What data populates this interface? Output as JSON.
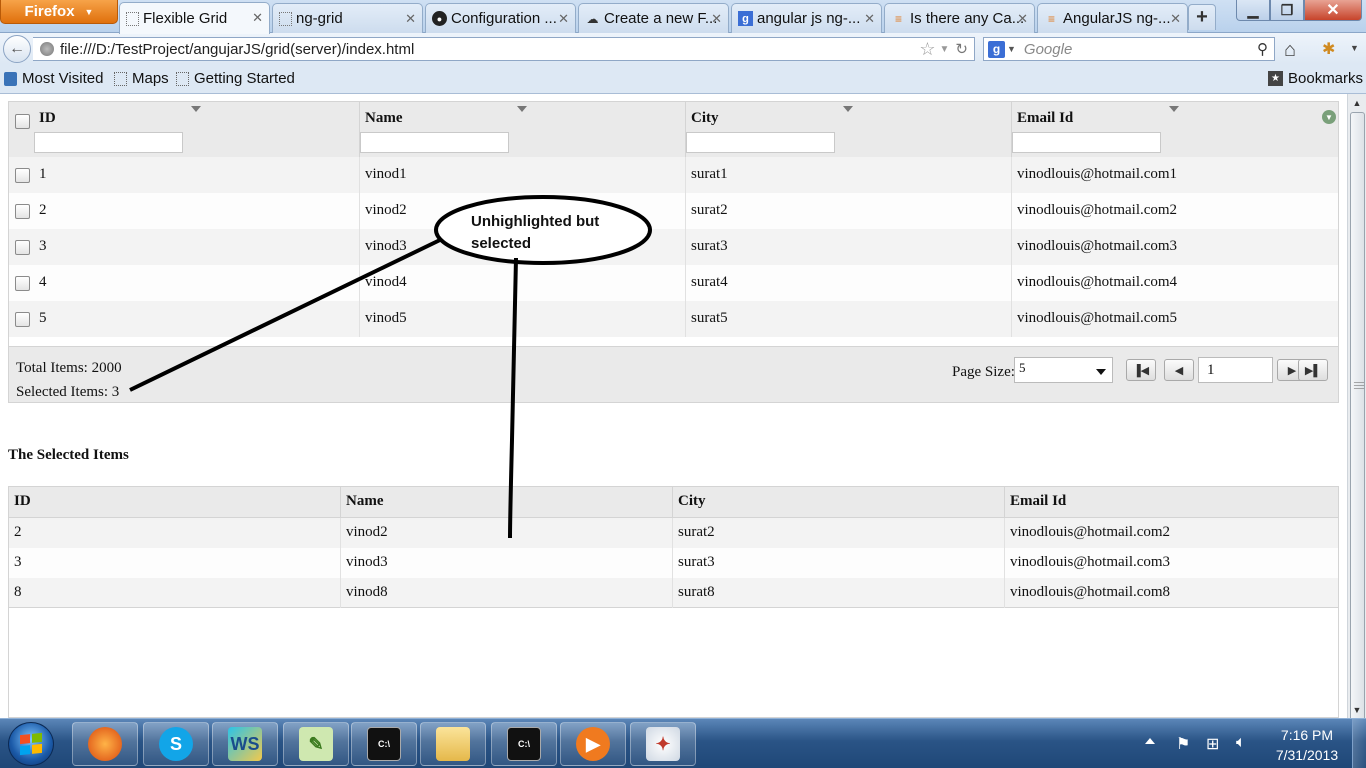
{
  "browser": {
    "menu_button": "Firefox",
    "tabs": [
      {
        "label": "Flexible Grid",
        "icon": "blank-page-icon",
        "active": true
      },
      {
        "label": "ng-grid",
        "icon": "blank-page-icon",
        "active": false
      },
      {
        "label": "Configuration ...",
        "icon": "github-icon",
        "active": false
      },
      {
        "label": "Create a new F...",
        "icon": "cloud-icon",
        "active": false
      },
      {
        "label": "angular js ng-...",
        "icon": "google-icon",
        "active": false
      },
      {
        "label": "Is there any Ca...",
        "icon": "stackoverflow-icon",
        "active": false
      },
      {
        "label": "AngularJS ng-...",
        "icon": "stackoverflow-icon",
        "active": false
      }
    ],
    "url": "file:///D:/TestProject/angujarJS/grid(server)/index.html",
    "search_placeholder": "Google",
    "bookmarks": [
      "Most Visited",
      "Maps",
      "Getting Started"
    ],
    "bookmarks_menu": "Bookmarks"
  },
  "grid": {
    "columns": [
      "ID",
      "Name",
      "City",
      "Email Id"
    ],
    "rows": [
      {
        "id": "1",
        "name": "vinod1",
        "city": "surat1",
        "email": "vinodlouis@hotmail.com1"
      },
      {
        "id": "2",
        "name": "vinod2",
        "city": "surat2",
        "email": "vinodlouis@hotmail.com2"
      },
      {
        "id": "3",
        "name": "vinod3",
        "city": "surat3",
        "email": "vinodlouis@hotmail.com3"
      },
      {
        "id": "4",
        "name": "vinod4",
        "city": "surat4",
        "email": "vinodlouis@hotmail.com4"
      },
      {
        "id": "5",
        "name": "vinod5",
        "city": "surat5",
        "email": "vinodlouis@hotmail.com5"
      }
    ],
    "footer": {
      "total_items": "Total Items: 2000",
      "selected_items": "Selected Items: 3",
      "page_size_label": "Page Size:",
      "page_size_value": "5",
      "page_number": "1"
    }
  },
  "selected_section": {
    "heading": "The Selected Items",
    "columns": [
      "ID",
      "Name",
      "City",
      "Email Id"
    ],
    "rows": [
      {
        "id": "2",
        "name": "vinod2",
        "city": "surat2",
        "email": "vinodlouis@hotmail.com2"
      },
      {
        "id": "3",
        "name": "vinod3",
        "city": "surat3",
        "email": "vinodlouis@hotmail.com3"
      },
      {
        "id": "8",
        "name": "vinod8",
        "city": "surat8",
        "email": "vinodlouis@hotmail.com8"
      }
    ]
  },
  "annotation": {
    "callout_text": "Unhighlighted but selected"
  },
  "taskbar": {
    "clock_time": "7:16 PM",
    "clock_date": "7/31/2013",
    "apps": [
      "firefox-icon",
      "skype-icon",
      "webstorm-icon",
      "notepad-plus-icon",
      "cmd-icon",
      "explorer-icon",
      "cmd-icon",
      "media-player-icon",
      "paint-icon"
    ]
  }
}
